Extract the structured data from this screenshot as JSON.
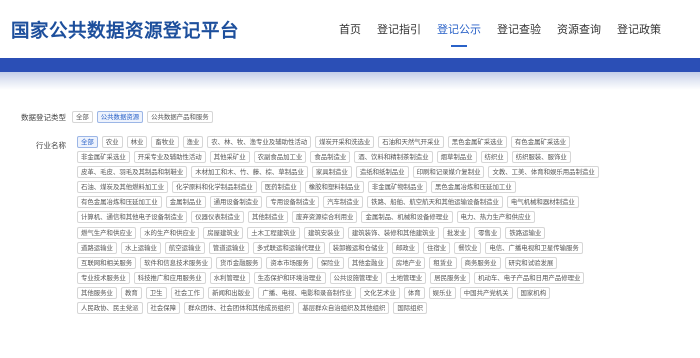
{
  "site": {
    "title": "国家公共数据资源登记平台"
  },
  "nav": {
    "items": [
      {
        "label": "首页",
        "active": false
      },
      {
        "label": "登记指引",
        "active": false
      },
      {
        "label": "登记公示",
        "active": true
      },
      {
        "label": "登记查验",
        "active": false
      },
      {
        "label": "资源查询",
        "active": false
      },
      {
        "label": "登记政策",
        "active": false
      }
    ]
  },
  "colors": {
    "brand": "#1d4f9c",
    "accent": "#2a62c8",
    "banner": "#2b4fb6"
  },
  "filters": {
    "type_label": "数据登记类型",
    "types": [
      {
        "label": "全部",
        "active": false
      },
      {
        "label": "公共数据资源",
        "active": true
      },
      {
        "label": "公共数据产品和服务",
        "active": false
      }
    ],
    "industry_label": "行业名称",
    "industry_rows": [
      [
        {
          "label": "全部",
          "active": true
        },
        {
          "label": "农业"
        },
        {
          "label": "林业"
        },
        {
          "label": "畜牧业"
        },
        {
          "label": "渔业"
        },
        {
          "label": "农、林、牧、渔专业及辅助性活动"
        },
        {
          "label": "煤炭开采和洗选业"
        },
        {
          "label": "石油和天然气开采业"
        },
        {
          "label": "黑色金属矿采选业"
        },
        {
          "label": "有色金属矿采选业"
        }
      ],
      [
        {
          "label": "非金属矿采选业"
        },
        {
          "label": "开采专业及辅助性活动"
        },
        {
          "label": "其他采矿业"
        },
        {
          "label": "农副食品加工业"
        },
        {
          "label": "食品制造业"
        },
        {
          "label": "酒、饮料和精制茶制造业"
        },
        {
          "label": "烟草制品业"
        },
        {
          "label": "纺织业"
        },
        {
          "label": "纺织服装、服饰业"
        }
      ],
      [
        {
          "label": "皮革、毛皮、羽毛及其制品和制鞋业"
        },
        {
          "label": "木材加工和木、竹、藤、棕、草制品业"
        },
        {
          "label": "家具制造业"
        },
        {
          "label": "造纸和纸制品业"
        },
        {
          "label": "印刷和记录媒介复制业"
        },
        {
          "label": "文教、工美、体育和娱乐用品制造业"
        }
      ],
      [
        {
          "label": "石油、煤炭及其他燃料加工业"
        },
        {
          "label": "化学原料和化学制品制造业"
        },
        {
          "label": "医药制造业"
        },
        {
          "label": "橡胶和塑料制品业"
        },
        {
          "label": "非金属矿物制品业"
        },
        {
          "label": "黑色金属冶炼和压延加工业"
        }
      ],
      [
        {
          "label": "有色金属冶炼和压延加工业"
        },
        {
          "label": "金属制品业"
        },
        {
          "label": "通用设备制造业"
        },
        {
          "label": "专用设备制造业"
        },
        {
          "label": "汽车制造业"
        },
        {
          "label": "铁路、船舶、航空航天和其他运输设备制造业"
        },
        {
          "label": "电气机械和器材制造业"
        }
      ],
      [
        {
          "label": "计算机、通信和其他电子设备制造业"
        },
        {
          "label": "仪器仪表制造业"
        },
        {
          "label": "其他制造业"
        },
        {
          "label": "废弃资源综合利用业"
        },
        {
          "label": "金属制品、机械和设备修理业"
        },
        {
          "label": "电力、热力生产和供应业"
        }
      ],
      [
        {
          "label": "燃气生产和供应业"
        },
        {
          "label": "水的生产和供应业"
        },
        {
          "label": "房屋建筑业"
        },
        {
          "label": "土木工程建筑业"
        },
        {
          "label": "建筑安装业"
        },
        {
          "label": "建筑装饰、装修和其他建筑业"
        },
        {
          "label": "批发业"
        },
        {
          "label": "零售业"
        },
        {
          "label": "铁路运输业"
        }
      ],
      [
        {
          "label": "道路运输业"
        },
        {
          "label": "水上运输业"
        },
        {
          "label": "航空运输业"
        },
        {
          "label": "管道运输业"
        },
        {
          "label": "多式联运和运输代理业"
        },
        {
          "label": "装卸搬运和仓储业"
        },
        {
          "label": "邮政业"
        },
        {
          "label": "住宿业"
        },
        {
          "label": "餐饮业"
        },
        {
          "label": "电信、广播电视和卫星传输服务"
        }
      ],
      [
        {
          "label": "互联网和相关服务"
        },
        {
          "label": "软件和信息技术服务业"
        },
        {
          "label": "货币金融服务"
        },
        {
          "label": "资本市场服务"
        },
        {
          "label": "保险业"
        },
        {
          "label": "其他金融业"
        },
        {
          "label": "房地产业"
        },
        {
          "label": "租赁业"
        },
        {
          "label": "商务服务业"
        },
        {
          "label": "研究和试验发展"
        }
      ],
      [
        {
          "label": "专业技术服务业"
        },
        {
          "label": "科技推广和应用服务业"
        },
        {
          "label": "水利管理业"
        },
        {
          "label": "生态保护和环境治理业"
        },
        {
          "label": "公共设施管理业"
        },
        {
          "label": "土地管理业"
        },
        {
          "label": "居民服务业"
        },
        {
          "label": "机动车、电子产品和日用产品修理业"
        }
      ],
      [
        {
          "label": "其他服务业"
        },
        {
          "label": "教育"
        },
        {
          "label": "卫生"
        },
        {
          "label": "社会工作"
        },
        {
          "label": "新闻和出版业"
        },
        {
          "label": "广播、电视、电影和录音制作业"
        },
        {
          "label": "文化艺术业"
        },
        {
          "label": "体育"
        },
        {
          "label": "娱乐业"
        },
        {
          "label": "中国共产党机关"
        },
        {
          "label": "国家机构"
        }
      ],
      [
        {
          "label": "人民政协、民主党派"
        },
        {
          "label": "社会保障"
        },
        {
          "label": "群众团体、社会团体和其他成员组织"
        },
        {
          "label": "基层群众自治组织及其他组织"
        },
        {
          "label": "国际组织"
        }
      ]
    ]
  }
}
